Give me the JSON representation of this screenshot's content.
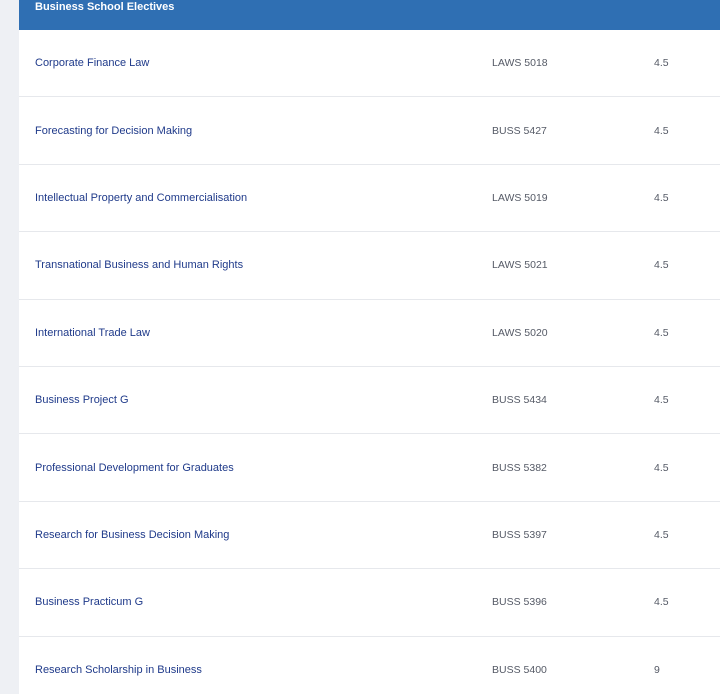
{
  "section": {
    "title": "Business School Electives"
  },
  "courses": [
    {
      "name": "Corporate Finance Law",
      "code": "LAWS 5018",
      "units": "4.5"
    },
    {
      "name": "Forecasting for Decision Making",
      "code": "BUSS 5427",
      "units": "4.5"
    },
    {
      "name": "Intellectual Property and Commercialisation",
      "code": "LAWS 5019",
      "units": "4.5"
    },
    {
      "name": "Transnational Business and Human Rights",
      "code": "LAWS 5021",
      "units": "4.5"
    },
    {
      "name": "International Trade Law",
      "code": "LAWS 5020",
      "units": "4.5"
    },
    {
      "name": "Business Project G",
      "code": "BUSS 5434",
      "units": "4.5"
    },
    {
      "name": "Professional Development for Graduates",
      "code": "BUSS 5382",
      "units": "4.5"
    },
    {
      "name": "Research for Business Decision Making",
      "code": "BUSS 5397",
      "units": "4.5"
    },
    {
      "name": "Business Practicum G",
      "code": "BUSS 5396",
      "units": "4.5"
    },
    {
      "name": "Research Scholarship in Business",
      "code": "BUSS 5400",
      "units": "9"
    }
  ],
  "colors": {
    "header_bg": "#2f6fb3",
    "link": "#1f3a8a",
    "muted_text": "#555a66",
    "page_bg": "#eef0f4"
  }
}
